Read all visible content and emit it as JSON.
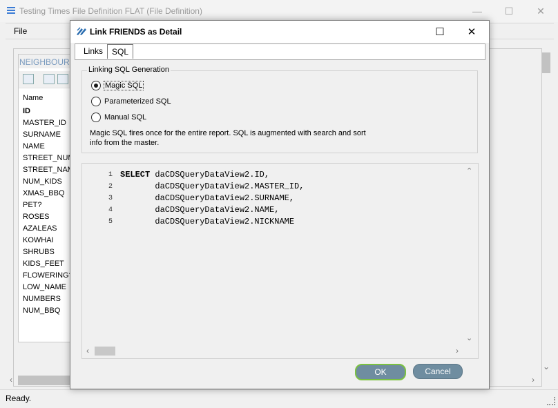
{
  "main_window": {
    "title": "Testing Times File Definition FLAT (File Definition)",
    "menu": [
      "File"
    ],
    "status": "Ready."
  },
  "neighbours_panel": {
    "title": "NEIGHBOURS",
    "column_header": "Name",
    "fields": [
      "ID",
      "MASTER_ID",
      "SURNAME",
      "NAME",
      "STREET_NUMBER",
      "STREET_NAME",
      "NUM_KIDS",
      "XMAS_BBQ",
      "PET?",
      "ROSES",
      "AZALEAS",
      "KOWHAI",
      "SHRUBS",
      "KIDS_FEET",
      "FLOWERING?",
      "LOW_NAME",
      "NUMBERS",
      "NUM_BBQ"
    ]
  },
  "dialog": {
    "title": "Link FRIENDS as Detail",
    "tabs": [
      {
        "label": "Links",
        "active": false
      },
      {
        "label": "SQL",
        "active": true
      }
    ],
    "group_label": "Linking SQL Generation",
    "options": [
      {
        "label": "Magic SQL",
        "selected": true
      },
      {
        "label": "Parameterized SQL",
        "selected": false
      },
      {
        "label": "Manual SQL",
        "selected": false
      }
    ],
    "description": "Magic SQL fires once for the entire report. SQL is augmented with search and sort info from the master.",
    "sql_lines": [
      {
        "n": "1",
        "keyword": "SELECT",
        "text": " daCDSQueryDataView2.ID,"
      },
      {
        "n": "2",
        "keyword": "",
        "text": "       daCDSQueryDataView2.MASTER_ID,"
      },
      {
        "n": "3",
        "keyword": "",
        "text": "       daCDSQueryDataView2.SURNAME,"
      },
      {
        "n": "4",
        "keyword": "",
        "text": "       daCDSQueryDataView2.NAME,"
      },
      {
        "n": "5",
        "keyword": "",
        "text": "       daCDSQueryDataView2.NICKNAME"
      }
    ],
    "ok_label": "OK",
    "cancel_label": "Cancel"
  },
  "colors": {
    "button_bg": "#6f8da0",
    "ok_focus_border": "#7bc142",
    "panel_title": "#7a9bbf"
  },
  "icons": [
    "app-menu-icon",
    "minimize-icon",
    "maximize-icon",
    "close-icon",
    "link-icon",
    "search-icon",
    "grid-icon",
    "grid-alt-icon",
    "scroll-left-icon",
    "scroll-right-icon",
    "scroll-up-icon",
    "scroll-down-icon",
    "resize-grip-icon"
  ]
}
